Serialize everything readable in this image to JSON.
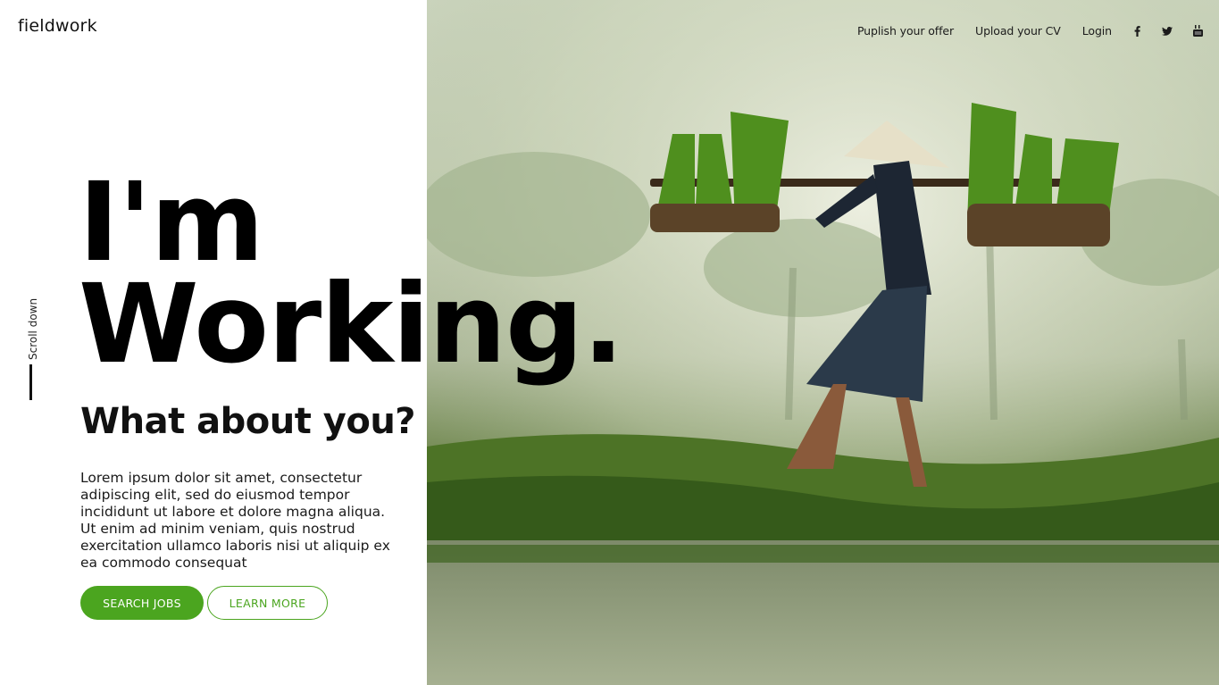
{
  "brand": {
    "logo_text": "fieldwork"
  },
  "nav": {
    "items": [
      "Puplish your offer",
      "Upload your CV",
      "Login"
    ],
    "social_icons": [
      "facebook-icon",
      "twitter-icon",
      "youtube-icon"
    ]
  },
  "scroll": {
    "label": "Scroll down"
  },
  "hero": {
    "headline_line1": "I'm",
    "headline_line2": "Working.",
    "subheadline": "What about you?",
    "body": "Lorem ipsum dolor sit amet, consectetur adipiscing elit, sed do eiusmod tempor incididunt ut labore et dolore magna aliqua. Ut enim ad minim veniam, quis nostrud exercitation ullamco laboris nisi ut aliquip ex ea commodo consequat",
    "primary_button": "SEARCH JOBS",
    "secondary_button": "LEARN MORE"
  },
  "colors": {
    "accent": "#4ba51f",
    "text": "#111111",
    "background": "#ffffff"
  }
}
